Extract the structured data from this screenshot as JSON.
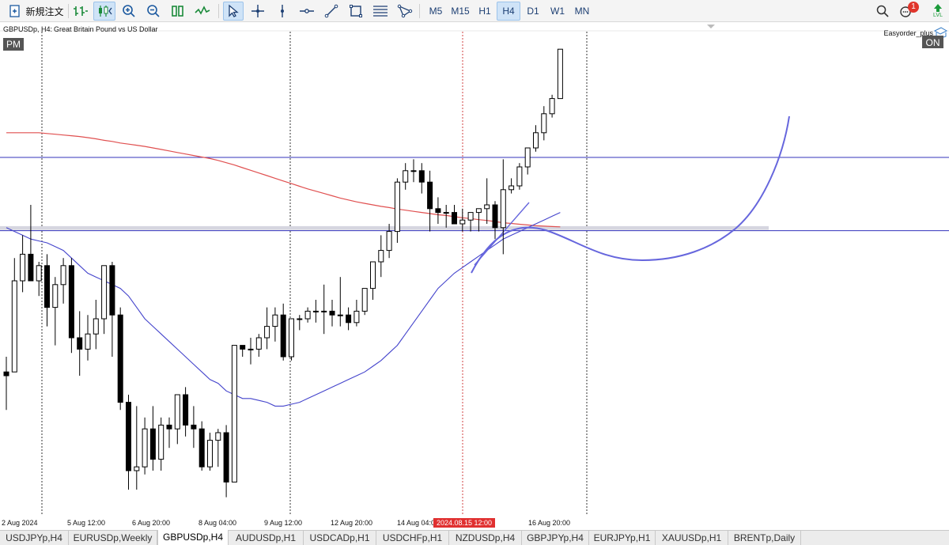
{
  "toolbar": {
    "new_order_label": "新規注文",
    "timeframes": [
      "M5",
      "M15",
      "H1",
      "H4",
      "D1",
      "W1",
      "MN"
    ],
    "active_timeframe": "H4",
    "notification_count": "1",
    "level_label": "LVL"
  },
  "chart": {
    "symbol_label": "GBPUSDp, H4:",
    "symbol_desc": "Great Britain Pound vs US Dollar",
    "session_badge": "PM",
    "ea_name": "Easyorder_plus",
    "ea_status": "ON"
  },
  "tabs": [
    "USDJPYp,H4",
    "EURUSDp,Weekly",
    "GBPUSDp,H4",
    "AUDUSDp,H1",
    "USDCADp,H1",
    "USDCHFp,H1",
    "NZDUSDp,H4",
    "GBPJPYp,H4",
    "EURJPYp,H1",
    "XAUUSDp,H1",
    "BRENTp,Daily"
  ],
  "active_tab": "GBPUSDp,H4",
  "colors": {
    "bull_fill": "#ffffff",
    "bear_fill": "#000000",
    "candle_stroke": "#000000",
    "ma_slow": "#e05050",
    "ma_fast": "#4444cc",
    "drawn_curve": "#6666dd",
    "hline": "#3333bb",
    "zone": "#d6d6e0",
    "vgrid": "#333333",
    "vgrid_red": "#d04040",
    "cursor_label_bg": "#e03030"
  },
  "chart_data": {
    "type": "candlestick",
    "ylim": [
      0,
      100
    ],
    "candles": [
      {
        "o": 36,
        "h": 40,
        "l": 26,
        "c": 35
      },
      {
        "o": 36,
        "h": 66,
        "l": 39,
        "c": 60
      },
      {
        "o": 60,
        "h": 72,
        "l": 57,
        "c": 67
      },
      {
        "o": 67,
        "h": 80,
        "l": 61,
        "c": 60
      },
      {
        "o": 60,
        "h": 65,
        "l": 56,
        "c": 64
      },
      {
        "o": 64,
        "h": 67,
        "l": 48,
        "c": 53
      },
      {
        "o": 53,
        "h": 61,
        "l": 43,
        "c": 59
      },
      {
        "o": 59,
        "h": 66,
        "l": 54,
        "c": 64
      },
      {
        "o": 64,
        "h": 66,
        "l": 41,
        "c": 45
      },
      {
        "o": 45,
        "h": 52,
        "l": 35,
        "c": 42
      },
      {
        "o": 42,
        "h": 51,
        "l": 39,
        "c": 46
      },
      {
        "o": 46,
        "h": 55,
        "l": 42,
        "c": 50
      },
      {
        "o": 50,
        "h": 64,
        "l": 46,
        "c": 64
      },
      {
        "o": 64,
        "h": 65,
        "l": 40,
        "c": 51
      },
      {
        "o": 51,
        "h": 53,
        "l": 26,
        "c": 28
      },
      {
        "o": 28,
        "h": 30,
        "l": 5,
        "c": 10
      },
      {
        "o": 10,
        "h": 27,
        "l": 5,
        "c": 11
      },
      {
        "o": 11,
        "h": 24,
        "l": 9,
        "c": 21
      },
      {
        "o": 21,
        "h": 27,
        "l": 10,
        "c": 13
      },
      {
        "o": 13,
        "h": 24,
        "l": 10,
        "c": 22
      },
      {
        "o": 22,
        "h": 24,
        "l": 16,
        "c": 21
      },
      {
        "o": 21,
        "h": 30,
        "l": 17,
        "c": 30
      },
      {
        "o": 30,
        "h": 32,
        "l": 19,
        "c": 22
      },
      {
        "o": 22,
        "h": 27,
        "l": 16,
        "c": 21
      },
      {
        "o": 21,
        "h": 23,
        "l": 10,
        "c": 11
      },
      {
        "o": 11,
        "h": 20,
        "l": 10,
        "c": 18
      },
      {
        "o": 18,
        "h": 21,
        "l": 11,
        "c": 20
      },
      {
        "o": 20,
        "h": 22,
        "l": 3,
        "c": 7
      },
      {
        "o": 7,
        "h": 43,
        "l": 7,
        "c": 43
      },
      {
        "o": 43,
        "h": 43,
        "l": 40,
        "c": 42
      },
      {
        "o": 42,
        "h": 45,
        "l": 38,
        "c": 42
      },
      {
        "o": 42,
        "h": 46,
        "l": 40,
        "c": 45
      },
      {
        "o": 45,
        "h": 53,
        "l": 42,
        "c": 48
      },
      {
        "o": 48,
        "h": 53,
        "l": 44,
        "c": 51
      },
      {
        "o": 51,
        "h": 54,
        "l": 39,
        "c": 40
      },
      {
        "o": 40,
        "h": 50,
        "l": 39,
        "c": 50
      },
      {
        "o": 50,
        "h": 51,
        "l": 47,
        "c": 50
      },
      {
        "o": 50,
        "h": 53,
        "l": 49,
        "c": 52
      },
      {
        "o": 52,
        "h": 55,
        "l": 49,
        "c": 52
      },
      {
        "o": 52,
        "h": 59,
        "l": 46,
        "c": 52
      },
      {
        "o": 52,
        "h": 55,
        "l": 48,
        "c": 51
      },
      {
        "o": 51,
        "h": 61,
        "l": 48,
        "c": 51
      },
      {
        "o": 51,
        "h": 53,
        "l": 47,
        "c": 49
      },
      {
        "o": 49,
        "h": 55,
        "l": 48,
        "c": 52
      },
      {
        "o": 52,
        "h": 58,
        "l": 51,
        "c": 58
      },
      {
        "o": 58,
        "h": 64,
        "l": 55,
        "c": 65
      },
      {
        "o": 65,
        "h": 72,
        "l": 61,
        "c": 68
      },
      {
        "o": 68,
        "h": 75,
        "l": 66,
        "c": 73
      },
      {
        "o": 73,
        "h": 87,
        "l": 70,
        "c": 86
      },
      {
        "o": 86,
        "h": 91,
        "l": 84,
        "c": 89
      },
      {
        "o": 89,
        "h": 92,
        "l": 86,
        "c": 89
      },
      {
        "o": 89,
        "h": 91,
        "l": 83,
        "c": 86
      },
      {
        "o": 86,
        "h": 89,
        "l": 73,
        "c": 79
      },
      {
        "o": 79,
        "h": 82,
        "l": 75,
        "c": 78
      },
      {
        "o": 78,
        "h": 80,
        "l": 74,
        "c": 78
      },
      {
        "o": 78,
        "h": 80,
        "l": 75,
        "c": 75
      },
      {
        "o": 75,
        "h": 79,
        "l": 73,
        "c": 76
      },
      {
        "o": 76,
        "h": 78,
        "l": 73,
        "c": 78
      },
      {
        "o": 78,
        "h": 79,
        "l": 73,
        "c": 79
      },
      {
        "o": 79,
        "h": 87,
        "l": 75,
        "c": 80
      },
      {
        "o": 80,
        "h": 81,
        "l": 71,
        "c": 74
      },
      {
        "o": 74,
        "h": 92,
        "l": 67,
        "c": 84
      },
      {
        "o": 84,
        "h": 87,
        "l": 83,
        "c": 85
      },
      {
        "o": 85,
        "h": 91,
        "l": 84,
        "c": 90
      },
      {
        "o": 90,
        "h": 95,
        "l": 88,
        "c": 95
      },
      {
        "o": 95,
        "h": 101,
        "l": 94,
        "c": 99
      },
      {
        "o": 99,
        "h": 106,
        "l": 97,
        "c": 104
      },
      {
        "o": 104,
        "h": 109,
        "l": 103,
        "c": 108
      },
      {
        "o": 108,
        "h": 121,
        "l": 108,
        "c": 121
      }
    ],
    "ma_slow": [
      99,
      99,
      99,
      99,
      99,
      98.8,
      98.6,
      98.4,
      98.2,
      98,
      97.7,
      97.4,
      97,
      96.7,
      96.3,
      96,
      95.7,
      95.4,
      95,
      94.6,
      94.2,
      93.8,
      93.4,
      93,
      92.6,
      92.2,
      91.7,
      91.1,
      90.5,
      89.8,
      89.1,
      88.4,
      87.7,
      87,
      86.3,
      85.6,
      84.9,
      84.2,
      83.6,
      83,
      82.4,
      81.8,
      81.3,
      80.8,
      80.4,
      80,
      79.6,
      79.3,
      78.9,
      78.6,
      78.3,
      78,
      77.7,
      77.4,
      77.2,
      76.9,
      76.6,
      76.4,
      76.1,
      75.9,
      75.6,
      75.3,
      75.1,
      74.9,
      74.7,
      74.5,
      74.4,
      74.3,
      74.2
    ],
    "ma_fast": [
      74,
      73,
      72,
      71,
      70.5,
      70,
      69,
      68,
      66,
      64,
      62,
      61,
      60,
      59,
      58,
      56,
      53,
      50,
      48,
      46,
      44,
      42,
      40,
      38,
      36,
      34,
      33,
      31,
      30,
      29,
      29,
      28.5,
      28,
      27,
      27,
      27.5,
      28,
      29,
      30,
      31,
      32,
      33,
      34,
      35,
      36,
      37.5,
      39,
      41,
      43,
      46,
      49,
      52,
      55,
      58,
      60,
      62,
      63.5,
      65,
      66.5,
      68,
      69.5,
      71,
      72,
      73,
      74,
      75,
      76,
      77,
      78
    ],
    "hlines": [
      92.5,
      73.2
    ],
    "zone": [
      73.4,
      74.4
    ],
    "x_labels": [
      "2 Aug 2024",
      "5 Aug 12:00",
      "6 Aug 20:00",
      "8 Aug 04:00",
      "9 Aug 12:00",
      "12 Aug 20:00",
      "14 Aug 04:00",
      "16 Aug 20:00"
    ],
    "cursor_label": "2024.08.15 12:00"
  }
}
